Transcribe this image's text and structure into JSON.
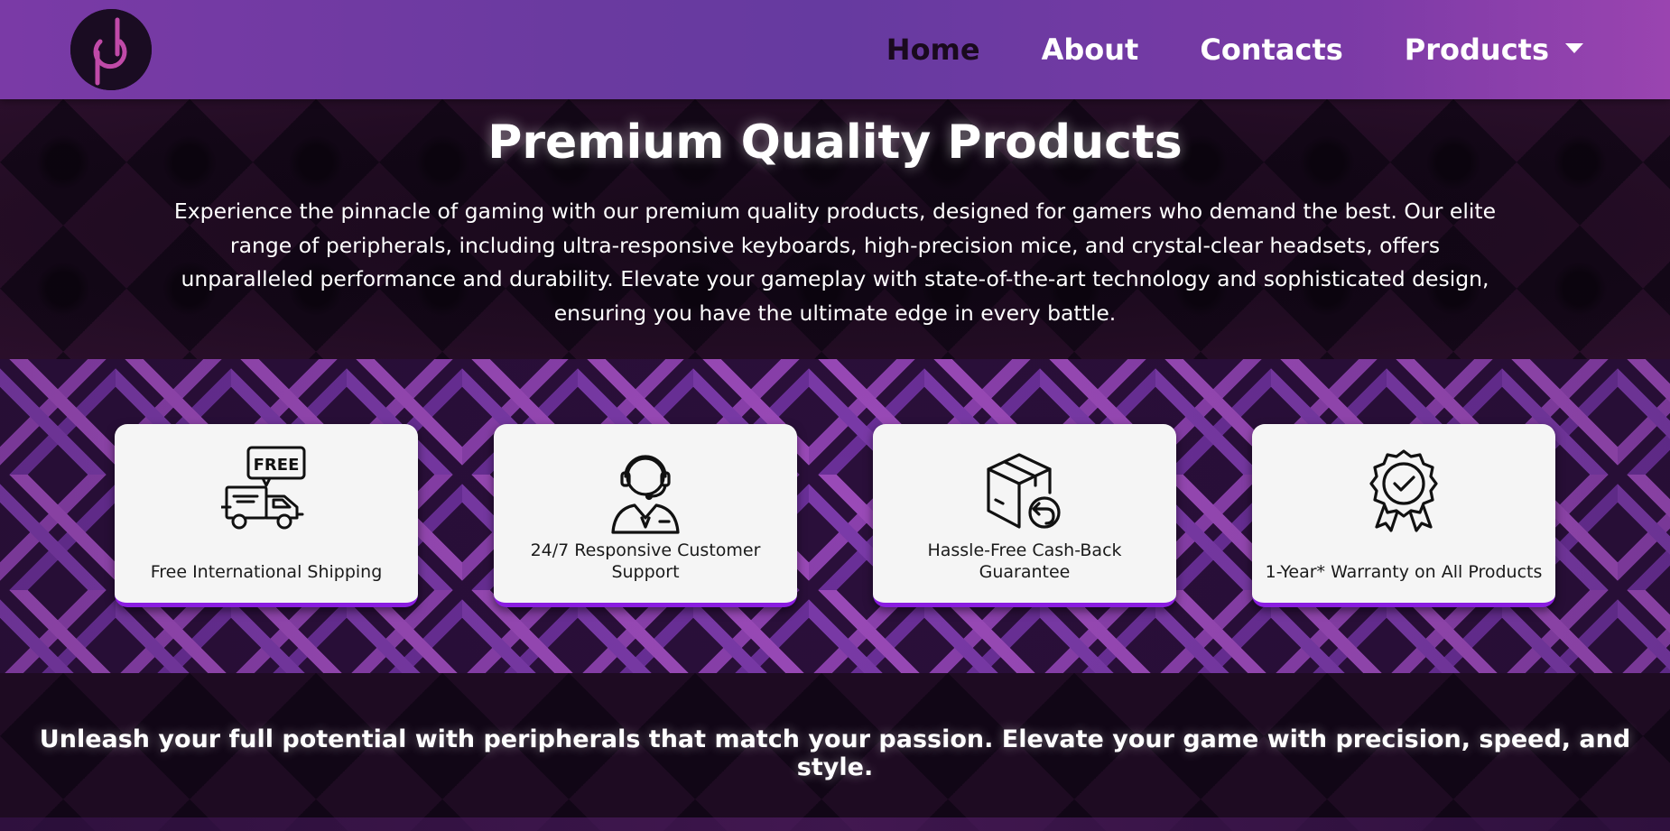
{
  "nav": {
    "logo": "power-pd-logo-icon",
    "links": [
      {
        "label": "Home",
        "active": true
      },
      {
        "label": "About",
        "active": false
      },
      {
        "label": "Contacts",
        "active": false
      },
      {
        "label": "Products",
        "active": false
      }
    ]
  },
  "hero": {
    "title": "Premium Quality Products",
    "text": "Experience the pinnacle of gaming with our premium quality products, designed for gamers who demand the best. Our elite range of peripherals, including ultra-responsive keyboards, high-precision mice, and crystal-clear headsets, offers unparalleled performance and durability. Elevate your gameplay with state-of-the-art technology and sophisticated design, ensuring you have the ultimate edge in every battle."
  },
  "features": [
    {
      "label": "Free International Shipping",
      "icon": "free-shipping-truck-icon",
      "badge": "FREE"
    },
    {
      "label": "24/7 Responsive Customer Support",
      "icon": "customer-support-headset-icon"
    },
    {
      "label": "Hassle-Free Cash-Back Guarantee",
      "icon": "box-return-icon"
    },
    {
      "label": "1-Year* Warranty on All Products",
      "icon": "warranty-badge-icon"
    }
  ],
  "tagline": "Unleash your full potential with peripherals that match your passion. Elevate your game with precision, speed, and style.",
  "colors": {
    "nav_gradient_mid": "#663aa0",
    "card_accent": "#8a1de0",
    "logo_accent": "#c04aa8"
  }
}
